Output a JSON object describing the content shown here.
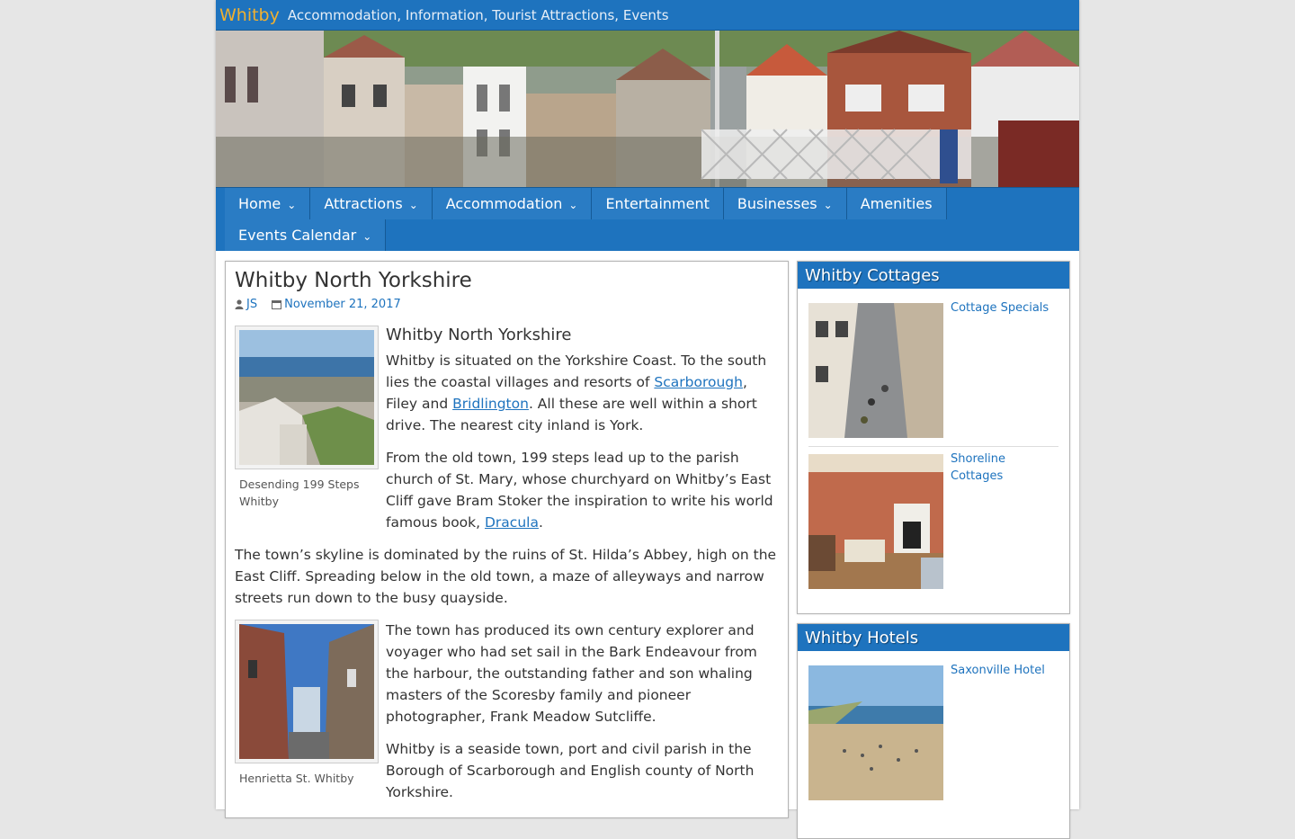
{
  "site": {
    "title": "Whitby",
    "tagline": "Accommodation, Information, Tourist Attractions, Events"
  },
  "nav": {
    "items": [
      {
        "label": "Home",
        "dropdown": true
      },
      {
        "label": "Attractions",
        "dropdown": true
      },
      {
        "label": "Accommodation",
        "dropdown": true
      },
      {
        "label": "Entertainment",
        "dropdown": false
      },
      {
        "label": "Businesses",
        "dropdown": true
      },
      {
        "label": "Amenities",
        "dropdown": false
      },
      {
        "label": "Events Calendar",
        "dropdown": true
      }
    ]
  },
  "post": {
    "title": "Whitby North Yorkshire",
    "author": "JS",
    "date": "November 21, 2017",
    "heading": "Whitby North Yorkshire",
    "figure1_caption": "Desending 199 Steps Whitby",
    "figure2_caption": "Henrietta St. Whitby",
    "p1_a": "Whitby is situated on the Yorkshire Coast. To the south lies the coastal villages and resorts of ",
    "p1_link1": "Scarborough",
    "p1_b": ", Filey and ",
    "p1_link2": "Bridlington",
    "p1_c": ". All these are well within a short drive. The nearest city inland is York.",
    "p2_a": "From the old town, 199 steps lead up to the parish church of St. Mary, whose churchyard on Whitby’s East Cliff gave Bram Stoker the inspiration to write his world famous book, ",
    "p2_link": "Dracula",
    "p2_b": ".",
    "p3": "The town’s skyline is dominated by the ruins of St. Hilda’s Abbey, high on the East Cliff. Spreading below in the old town, a maze of alleyways and narrow streets run down to the busy quayside.",
    "p4": "The town has produced its own century explorer and voyager who had set sail in the Bark Endeavour from the harbour, the outstanding father and son whaling masters of the Scoresby family and pioneer photographer, Frank Meadow Sutcliffe.",
    "p5": "Whitby is a seaside town, port and civil parish in the Borough of Scarborough and English county of North Yorkshire."
  },
  "sidebar": {
    "cottages": {
      "title": "Whitby Cottages",
      "items": [
        {
          "label": "Cottage Specials"
        },
        {
          "label": "Shoreline Cottages"
        }
      ]
    },
    "hotels": {
      "title": "Whitby Hotels",
      "items": [
        {
          "label": "Saxonville Hotel"
        }
      ]
    }
  },
  "colors": {
    "brand_blue": "#1e73be",
    "title_gold": "#f0b030",
    "page_bg": "#e6e6e6"
  },
  "icons": {
    "author": "user-icon",
    "date": "calendar-icon",
    "nav_dropdown": "chevron-down-icon"
  }
}
